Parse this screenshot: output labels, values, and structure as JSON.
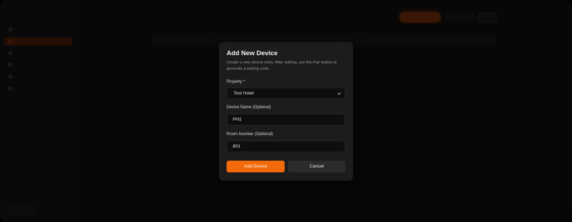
{
  "modal": {
    "title": "Add New Device",
    "description": "Create a new device entry. After adding, use the Pair button to generate a pairing code.",
    "property": {
      "label": "Property *",
      "selected": "Test Hotel"
    },
    "device_name": {
      "label": "Device Name (Optional)",
      "value": "PH1"
    },
    "room_number": {
      "label": "Room Number (Optional)",
      "value": "801"
    },
    "add_button": "Add Device",
    "cancel_button": "Cancel"
  },
  "colors": {
    "accent": "#f26a0a",
    "modal_bg": "#1c1c1c",
    "input_bg": "#0e0e0e",
    "cancel_bg": "#2c2c2c"
  },
  "icons": {
    "select_caret": "chevron-down-icon"
  }
}
